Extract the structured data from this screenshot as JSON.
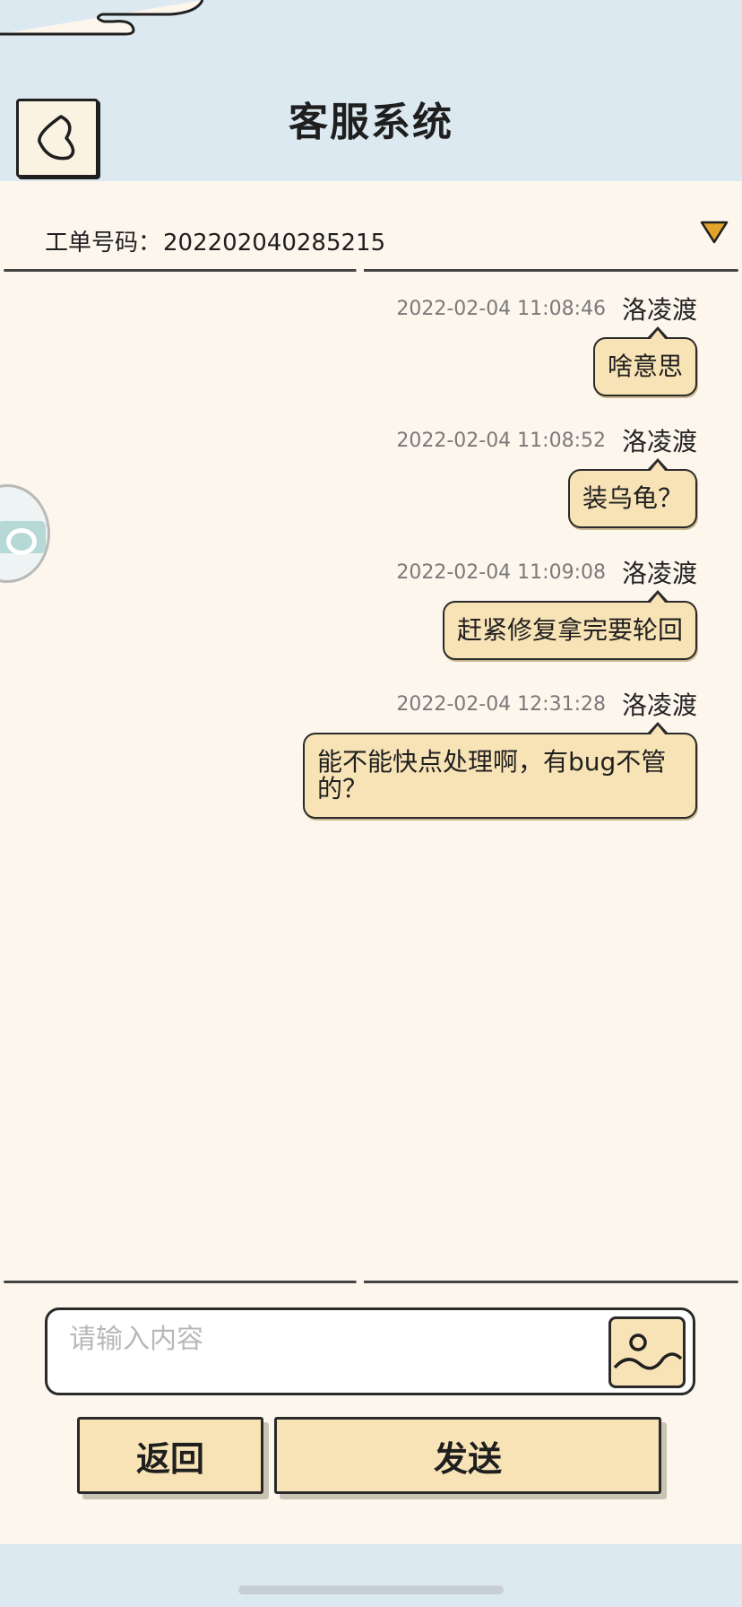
{
  "header": {
    "title": "客服系统"
  },
  "ticket": {
    "label": "工单号码：",
    "number": "202202040285215"
  },
  "messages": [
    {
      "time": "2022-02-04 11:08:46",
      "user": "洛凌渡",
      "text": "啥意思"
    },
    {
      "time": "2022-02-04 11:08:52",
      "user": "洛凌渡",
      "text": "装乌龟？"
    },
    {
      "time": "2022-02-04 11:09:08",
      "user": "洛凌渡",
      "text": "赶紧修复拿完要轮回"
    },
    {
      "time": "2022-02-04 12:31:28",
      "user": "洛凌渡",
      "text": "能不能快点处理啊，有bug不管的？"
    }
  ],
  "input": {
    "placeholder": "请输入内容",
    "value": ""
  },
  "buttons": {
    "back_label": "返回",
    "send_label": "发送"
  },
  "icons": {
    "back": "chevron-left-icon",
    "dropdown": "triangle-down-icon",
    "image": "image-icon"
  },
  "colors": {
    "header_bg": "#dce9f1",
    "content_bg": "#fcf6ec",
    "bubble_bg": "#f8e3b6",
    "border": "#2a2a2a",
    "dropdown_accent": "#e3a42a"
  }
}
